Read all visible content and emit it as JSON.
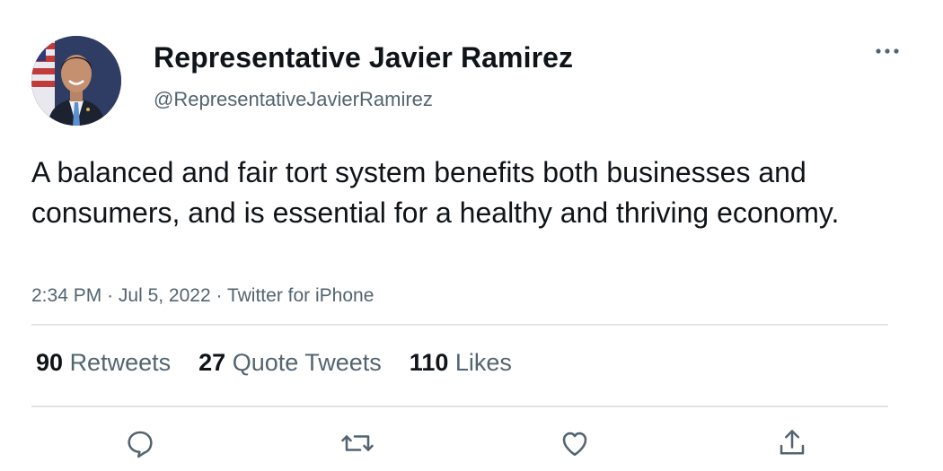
{
  "author": {
    "display_name": "Representative Javier Ramirez",
    "handle": "@RepresentativeJavierRamirez"
  },
  "tweet": {
    "text": "A balanced and fair tort system benefits both businesses and consumers, and is essential for a healthy and thriving economy.",
    "time": "2:34 PM",
    "date": "Jul 5, 2022",
    "source": "Twitter for iPhone",
    "separator": "·"
  },
  "stats": {
    "retweets_count": "90",
    "retweets_label": "Retweets",
    "quotes_count": "27",
    "quotes_label": "Quote Tweets",
    "likes_count": "110",
    "likes_label": "Likes"
  },
  "colors": {
    "text_primary": "#0f1419",
    "text_secondary": "#536471",
    "divider": "#e1e4e6"
  },
  "icons": {
    "more": "more-horizontal-icon",
    "reply": "reply-icon",
    "retweet": "retweet-icon",
    "like": "heart-icon",
    "share": "share-icon"
  }
}
